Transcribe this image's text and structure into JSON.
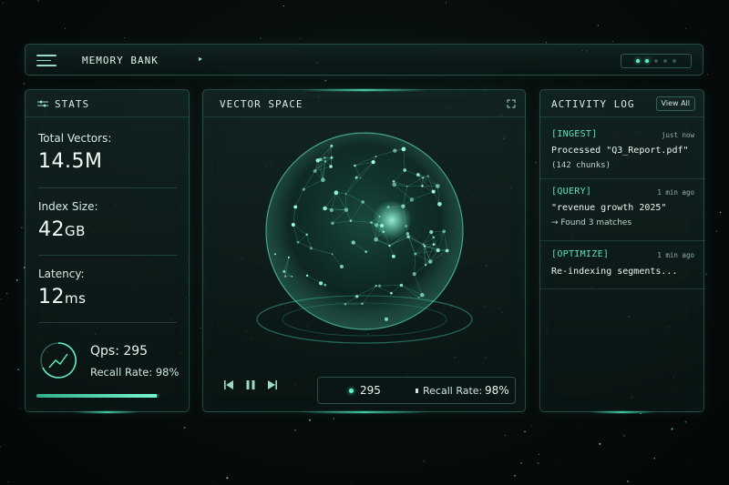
{
  "header": {
    "title": "MEMORY BANK",
    "dots": [
      true,
      true,
      false,
      false,
      false
    ]
  },
  "stats": {
    "title": "STATS",
    "total_vectors_label": "Total Vectors:",
    "total_vectors_value": "14.5M",
    "index_size_label": "Index Size:",
    "index_size_value": "42",
    "index_size_unit": "GB",
    "latency_label": "Latency:",
    "latency_value": "12",
    "latency_unit": "ms",
    "qps_text": "Qps: 295",
    "recall_text": "Recall Rate: 98%",
    "progress_fraction": 0.98
  },
  "vector_space": {
    "title": "VECTOR SPACE",
    "readout_value": "295",
    "readout_label": "Recall Rate:",
    "readout_percent": "98%"
  },
  "activity": {
    "title": "ACTIVITY LOG",
    "view_all": "View All",
    "entries": [
      {
        "tag": "[INGEST]",
        "time": "just now",
        "line1": "Processed \"Q3_Report.pdf\"",
        "line2": "(142 chunks)"
      },
      {
        "tag": "[QUERY]",
        "time": "1 min ago",
        "line1": "\"revenue growth 2025\"",
        "line2": "→ Found 3 matches"
      },
      {
        "tag": "[OPTIMIZE]",
        "time": "1 min ago",
        "line1": "Re-indexing segments...",
        "line2": ""
      }
    ]
  },
  "colors": {
    "accent": "#5ff2c6",
    "tag": "#58e3b6",
    "background": "#070c0c"
  }
}
